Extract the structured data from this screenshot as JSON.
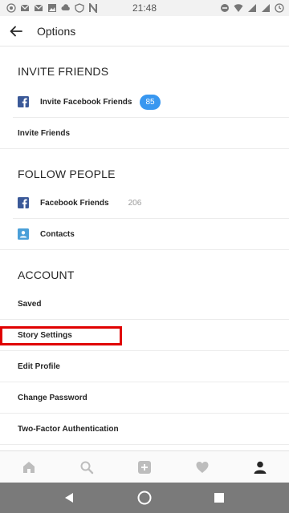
{
  "status_bar": {
    "time": "21:48",
    "left_icons": [
      "whatsapp-icon",
      "gmail-icon",
      "gmail-icon",
      "image-icon",
      "cloud-icon",
      "vpn-icon",
      "n-icon"
    ],
    "right_icons": [
      "dnd-icon",
      "wifi-icon",
      "signal-icon",
      "signal-icon",
      "battery-icon"
    ]
  },
  "header": {
    "title": "Options",
    "back_icon": "arrow-left-icon"
  },
  "sections": {
    "invite": {
      "title": "INVITE FRIENDS",
      "items": [
        {
          "label": "Invite Facebook Friends",
          "icon": "facebook-icon",
          "badge": "85"
        },
        {
          "label": "Invite Friends"
        }
      ]
    },
    "follow": {
      "title": "FOLLOW PEOPLE",
      "items": [
        {
          "label": "Facebook Friends",
          "icon": "facebook-icon",
          "count": "206"
        },
        {
          "label": "Contacts",
          "icon": "contacts-icon"
        }
      ]
    },
    "account": {
      "title": "ACCOUNT",
      "items": [
        {
          "label": "Saved"
        },
        {
          "label": "Story Settings"
        },
        {
          "label": "Edit Profile"
        },
        {
          "label": "Change Password"
        },
        {
          "label": "Two-Factor Authentication"
        }
      ]
    }
  },
  "tabbar": {
    "items": [
      "home-icon",
      "search-icon",
      "add-icon",
      "heart-icon",
      "profile-icon"
    ],
    "active": "profile-icon"
  },
  "navbar": {
    "items": [
      "back-triangle-icon",
      "home-circle-icon",
      "recents-square-icon"
    ]
  },
  "colors": {
    "accent": "#3897f0",
    "facebook": "#3b5998",
    "highlight": "#e00000",
    "navbar": "#7a7a7a"
  }
}
